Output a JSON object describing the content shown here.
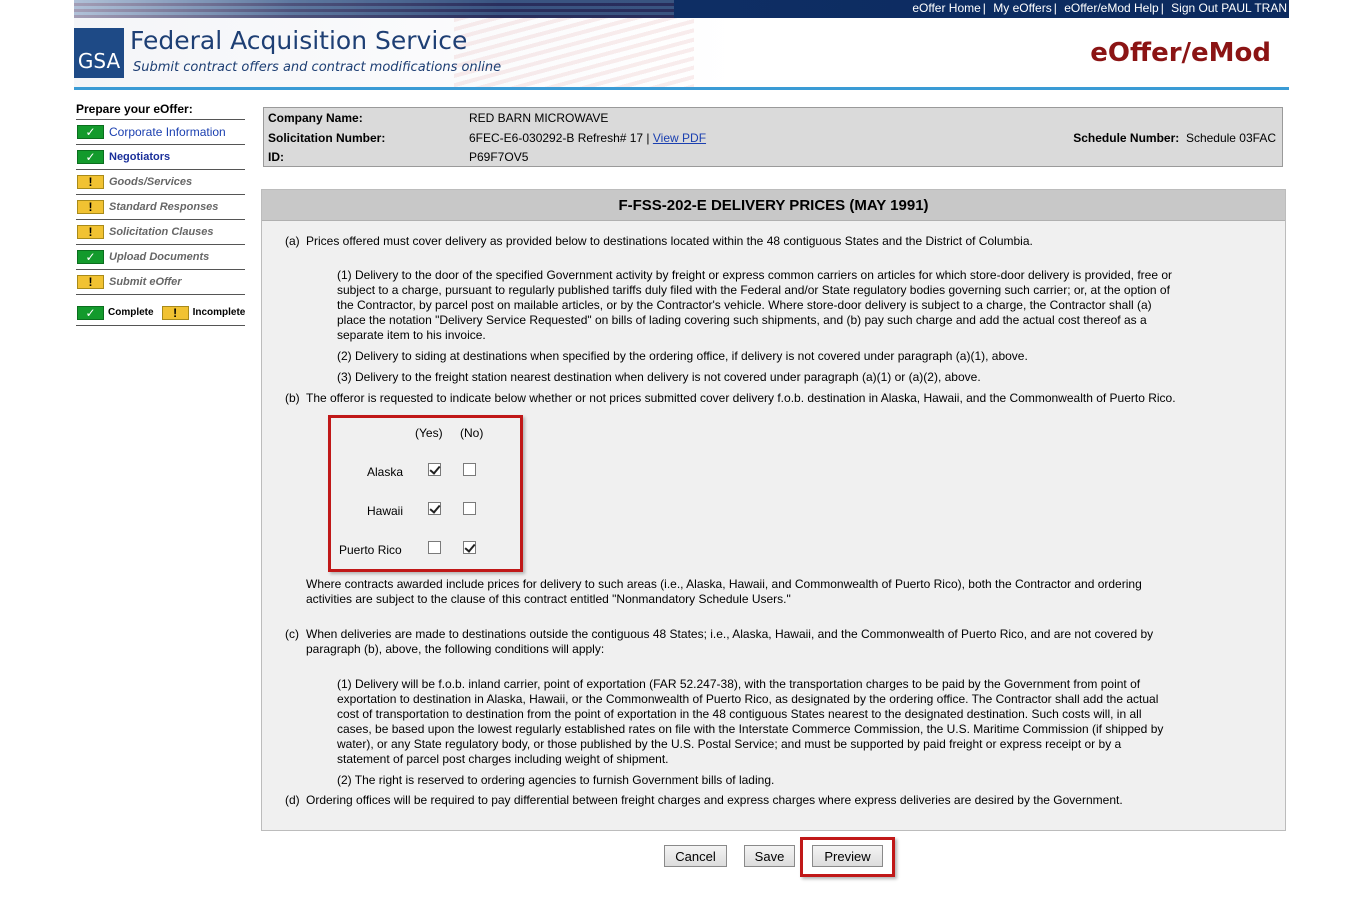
{
  "header": {
    "links": [
      "eOffer Home",
      "My eOffers",
      "eOffer/eMod Help",
      "Sign Out PAUL TRAN"
    ],
    "logo_text": "GSA",
    "title": "Federal Acquisition Service",
    "subtitle": "Submit contract offers and contract modifications online",
    "brand": "eOffer/eMod",
    "colors": {
      "brand": "#8b1414",
      "nav": "#0b2a5e",
      "rule": "#3a9bd5"
    }
  },
  "sidebar": {
    "heading": "Prepare your eOffer:",
    "steps": [
      {
        "label": "Corporate Information",
        "status": "complete"
      },
      {
        "label": "Negotiators",
        "status": "complete"
      },
      {
        "label": "Goods/Services",
        "status": "incomplete"
      },
      {
        "label": "Standard Responses",
        "status": "incomplete"
      },
      {
        "label": "Solicitation Clauses",
        "status": "incomplete"
      },
      {
        "label": "Upload Documents",
        "status": "complete"
      },
      {
        "label": "Submit eOffer",
        "status": "incomplete"
      }
    ],
    "legend": {
      "complete": "Complete",
      "incomplete": "Incomplete"
    },
    "icons": {
      "complete": "check-icon",
      "incomplete": "exclamation-icon"
    }
  },
  "info": {
    "company_label": "Company Name:",
    "company_value": "RED BARN MICROWAVE",
    "solicitation_label": "Solicitation Number:",
    "solicitation_value": "6FEC-E6-030292-B Refresh# 17 |",
    "view_pdf": "View PDF",
    "id_label": "ID:",
    "id_value": "P69F7OV5",
    "schedule_label": "Schedule Number:",
    "schedule_value": "Schedule 03FAC"
  },
  "clause": {
    "title": "F-FSS-202-E DELIVERY PRICES (MAY 1991)",
    "a_tag": "(a)",
    "a": "Prices offered must cover delivery as provided below to destinations located within the 48 contiguous States and the District of Columbia.",
    "a1": [
      "(1) Delivery to the door of the specified Government activity by freight or express common carriers on articles for which store-door delivery is provided, free or",
      "subject to a charge, pursuant to regularly published tariffs duly filed with the Federal and/or State regulatory bodies governing such carrier; or, at the option of",
      "the Contractor, by parcel post on mailable articles, or by the Contractor's vehicle. Where store-door delivery is subject to a charge, the Contractor shall (a)",
      "place the notation \"Delivery Service Requested\" on bills of lading covering such shipments, and (b) pay such charge and add the actual cost thereof as a",
      "separate item to his invoice."
    ],
    "a2": "(2) Delivery to siding at destinations when specified by the ordering office, if delivery is not covered under paragraph (a)(1), above.",
    "a3": "(3) Delivery to the freight station nearest destination when delivery is not covered under paragraph (a)(1) or (a)(2), above.",
    "b_tag": "(b)",
    "b": "The offeror is requested to indicate below whether or not prices submitted cover delivery f.o.b. destination in Alaska, Hawaii, and the Commonwealth of Puerto Rico.",
    "b_note": [
      "Where contracts awarded include prices for delivery to such areas (i.e., Alaska, Hawaii, and Commonwealth of Puerto Rico), both the Contractor and ordering",
      "activities are subject to the clause of this contract entitled \"Nonmandatory Schedule Users.\""
    ],
    "c_tag": "(c)",
    "c": [
      "When deliveries are made to destinations outside the contiguous 48 States; i.e., Alaska, Hawaii, and the Commonwealth of Puerto Rico, and are not covered by",
      "paragraph (b), above, the following conditions will apply:"
    ],
    "c1": [
      "(1) Delivery will be f.o.b. inland carrier, point of exportation (FAR 52.247-38), with the transportation charges to be paid by the Government from point of",
      "exportation to destination in Alaska, Hawaii, or the Commonwealth of Puerto Rico, as designated by the ordering office. The Contractor shall add the actual",
      "cost of transportation to destination from the point of exportation in the 48 contiguous States nearest to the designated destination. Such costs will, in all",
      "cases, be based upon the lowest regularly established rates on file with the Interstate Commerce Commission, the U.S. Maritime Commission (if shipped by",
      "water), or any State regulatory body, or those published by the U.S. Postal Service; and must be supported by paid freight or express receipt or by a",
      "statement of parcel post charges including weight of shipment."
    ],
    "c2": "(2) The right is reserved to ordering agencies to furnish Government bills of lading.",
    "d_tag": "(d)",
    "d": "Ordering offices will be required to pay differential between freight charges and express charges where express deliveries are desired by the Government."
  },
  "delivery_grid": {
    "yes_label": "(Yes)",
    "no_label": "(No)",
    "rows": [
      {
        "label": "Alaska",
        "yes": true,
        "no": false
      },
      {
        "label": "Hawaii",
        "yes": true,
        "no": false
      },
      {
        "label": "Puerto Rico",
        "yes": false,
        "no": true
      }
    ]
  },
  "buttons": {
    "cancel": "Cancel",
    "save": "Save",
    "preview": "Preview"
  }
}
